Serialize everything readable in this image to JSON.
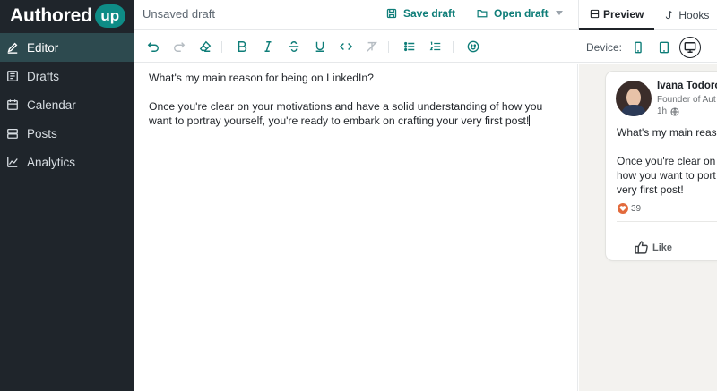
{
  "brand": {
    "name": "Authored",
    "badge": "up"
  },
  "sidebar": {
    "items": [
      {
        "label": "Editor",
        "icon": "pencil-icon",
        "active": true
      },
      {
        "label": "Drafts",
        "icon": "drafts-icon"
      },
      {
        "label": "Calendar",
        "icon": "calendar-icon"
      },
      {
        "label": "Posts",
        "icon": "posts-icon"
      },
      {
        "label": "Analytics",
        "icon": "analytics-icon"
      }
    ]
  },
  "topbar": {
    "draft_title": "Unsaved draft",
    "save_label": "Save draft",
    "open_label": "Open draft",
    "tabs": [
      {
        "label": "Preview",
        "icon": "preview-icon",
        "active": true
      },
      {
        "label": "Hooks",
        "icon": "hooks-icon"
      }
    ]
  },
  "toolbar": {
    "device_label": "Device:",
    "devices": [
      "mobile-icon",
      "tablet-icon",
      "desktop-icon"
    ],
    "active_device": "desktop-icon"
  },
  "editor": {
    "paragraphs": [
      "What's my main reason for being on LinkedIn?",
      "Once you're clear on your motivations and have a solid understanding of how you want to portray yourself, you're ready to embark on crafting your very first post!"
    ]
  },
  "preview": {
    "author_name": "Ivana Todoro",
    "author_title": "Founder of Aut",
    "time": "1h",
    "lines": [
      "What's my main reas",
      "Once you're clear on",
      "how you want to port",
      "very first post!"
    ],
    "reactions": "39",
    "like_label": "Like"
  },
  "colors": {
    "accent": "#0e7d78",
    "sidebar": "#1f252b",
    "sidebar_active": "#2d4a4f"
  }
}
